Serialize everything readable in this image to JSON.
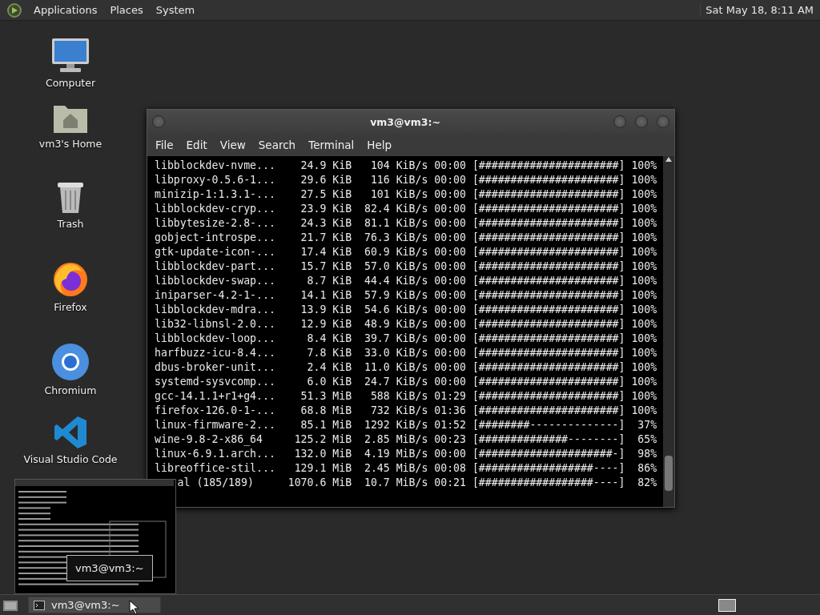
{
  "top_panel": {
    "menus": [
      "Applications",
      "Places",
      "System"
    ],
    "clock": "Sat May 18,  8:11 AM"
  },
  "desktop_icons": [
    {
      "label": "Computer",
      "kind": "computer"
    },
    {
      "label": "vm3's Home",
      "kind": "home"
    },
    {
      "label": "Trash",
      "kind": "trash"
    },
    {
      "label": "Firefox",
      "kind": "firefox"
    },
    {
      "label": "Chromium",
      "kind": "chromium"
    },
    {
      "label": "Visual Studio Code",
      "kind": "vscode"
    }
  ],
  "terminal": {
    "title": "vm3@vm3:~",
    "menu": [
      "File",
      "Edit",
      "View",
      "Search",
      "Terminal",
      "Help"
    ],
    "rows": [
      {
        "name": "libblockdev-nvme...",
        "size": "24.9 KiB",
        "speed": "104 KiB/s",
        "eta": "00:00",
        "bar": "[######################]",
        "percent": "100%"
      },
      {
        "name": "libproxy-0.5.6-1...",
        "size": "29.6 KiB",
        "speed": "116 KiB/s",
        "eta": "00:00",
        "bar": "[######################]",
        "percent": "100%"
      },
      {
        "name": "minizip-1:1.3.1-...",
        "size": "27.5 KiB",
        "speed": "101 KiB/s",
        "eta": "00:00",
        "bar": "[######################]",
        "percent": "100%"
      },
      {
        "name": "libblockdev-cryp...",
        "size": "23.9 KiB",
        "speed": "82.4 KiB/s",
        "eta": "00:00",
        "bar": "[######################]",
        "percent": "100%"
      },
      {
        "name": "libbytesize-2.8-...",
        "size": "24.3 KiB",
        "speed": "81.1 KiB/s",
        "eta": "00:00",
        "bar": "[######################]",
        "percent": "100%"
      },
      {
        "name": "gobject-introspe...",
        "size": "21.7 KiB",
        "speed": "76.3 KiB/s",
        "eta": "00:00",
        "bar": "[######################]",
        "percent": "100%"
      },
      {
        "name": "gtk-update-icon-...",
        "size": "17.4 KiB",
        "speed": "60.9 KiB/s",
        "eta": "00:00",
        "bar": "[######################]",
        "percent": "100%"
      },
      {
        "name": "libblockdev-part...",
        "size": "15.7 KiB",
        "speed": "57.0 KiB/s",
        "eta": "00:00",
        "bar": "[######################]",
        "percent": "100%"
      },
      {
        "name": "libblockdev-swap...",
        "size": "8.7 KiB",
        "speed": "44.4 KiB/s",
        "eta": "00:00",
        "bar": "[######################]",
        "percent": "100%"
      },
      {
        "name": "iniparser-4.2-1-...",
        "size": "14.1 KiB",
        "speed": "57.9 KiB/s",
        "eta": "00:00",
        "bar": "[######################]",
        "percent": "100%"
      },
      {
        "name": "libblockdev-mdra...",
        "size": "13.9 KiB",
        "speed": "54.6 KiB/s",
        "eta": "00:00",
        "bar": "[######################]",
        "percent": "100%"
      },
      {
        "name": "lib32-libnsl-2.0...",
        "size": "12.9 KiB",
        "speed": "48.9 KiB/s",
        "eta": "00:00",
        "bar": "[######################]",
        "percent": "100%"
      },
      {
        "name": "libblockdev-loop...",
        "size": "8.4 KiB",
        "speed": "39.7 KiB/s",
        "eta": "00:00",
        "bar": "[######################]",
        "percent": "100%"
      },
      {
        "name": "harfbuzz-icu-8.4...",
        "size": "7.8 KiB",
        "speed": "33.0 KiB/s",
        "eta": "00:00",
        "bar": "[######################]",
        "percent": "100%"
      },
      {
        "name": "dbus-broker-unit...",
        "size": "2.4 KiB",
        "speed": "11.0 KiB/s",
        "eta": "00:00",
        "bar": "[######################]",
        "percent": "100%"
      },
      {
        "name": "systemd-sysvcomp...",
        "size": "6.0 KiB",
        "speed": "24.7 KiB/s",
        "eta": "00:00",
        "bar": "[######################]",
        "percent": "100%"
      },
      {
        "name": "gcc-14.1.1+r1+g4...",
        "size": "51.3 MiB",
        "speed": "588 KiB/s",
        "eta": "01:29",
        "bar": "[######################]",
        "percent": "100%"
      },
      {
        "name": "firefox-126.0-1-...",
        "size": "68.8 MiB",
        "speed": "732 KiB/s",
        "eta": "01:36",
        "bar": "[######################]",
        "percent": "100%"
      },
      {
        "name": "linux-firmware-2...",
        "size": "85.1 MiB",
        "speed": "1292 KiB/s",
        "eta": "01:52",
        "bar": "[########--------------]",
        "percent": "37%"
      },
      {
        "name": "wine-9.8-2-x86_64",
        "size": "125.2 MiB",
        "speed": "2.85 MiB/s",
        "eta": "00:23",
        "bar": "[##############--------]",
        "percent": "65%"
      },
      {
        "name": "linux-6.9.1.arch...",
        "size": "132.0 MiB",
        "speed": "4.19 MiB/s",
        "eta": "00:00",
        "bar": "[#####################-]",
        "percent": "98%"
      },
      {
        "name": "libreoffice-stil...",
        "size": "129.1 MiB",
        "speed": "2.45 MiB/s",
        "eta": "00:08",
        "bar": "[##################----]",
        "percent": "86%"
      }
    ],
    "total_row": {
      "name": "al (185/189)",
      "size": "1070.6 MiB",
      "speed": "10.7 MiB/s",
      "eta": "00:21",
      "bar": "[##################----]",
      "percent": "82%"
    }
  },
  "preview": {
    "tooltip": "vm3@vm3:~"
  },
  "taskbar": {
    "tasks": [
      {
        "label": "vm3@vm3:~"
      }
    ]
  }
}
